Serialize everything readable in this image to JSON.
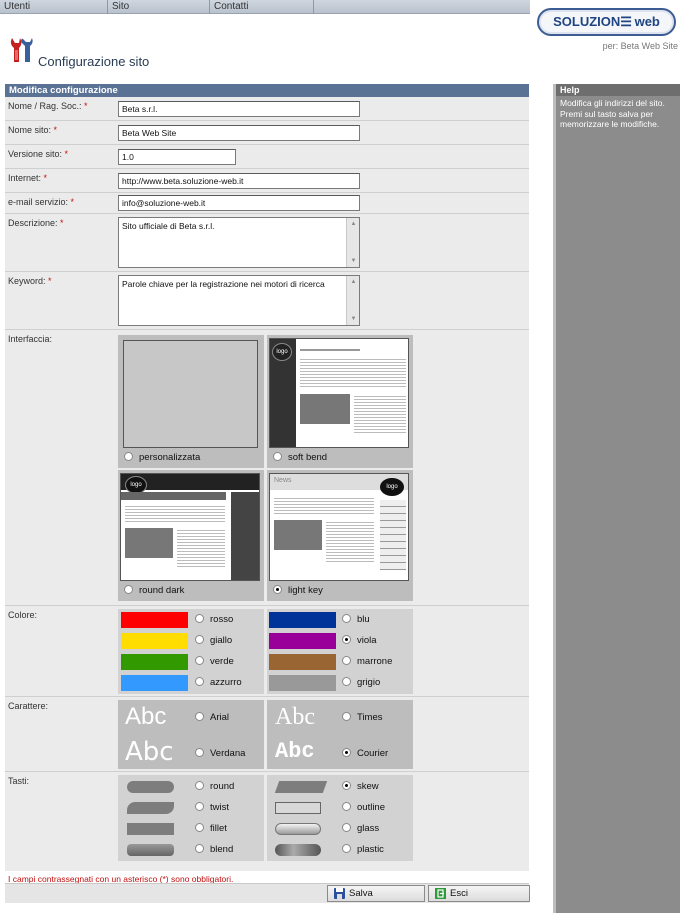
{
  "topnav": {
    "items": [
      "Utenti",
      "Sito",
      "Contatti"
    ]
  },
  "logo": {
    "text_a": "SOLUZION",
    "text_b": "web"
  },
  "byline": "per: Beta Web Site",
  "title": "Configurazione sito",
  "panel_header": "Modifica configurazione",
  "fields": {
    "ragsoc": {
      "label": "Nome / Rag. Soc.:",
      "value": "Beta s.r.l."
    },
    "nome": {
      "label": "Nome sito:",
      "value": "Beta Web Site"
    },
    "versione": {
      "label": "Versione sito:",
      "value": "1.0"
    },
    "internet": {
      "label": "Internet:",
      "value": "http://www.beta.soluzione-web.it"
    },
    "email": {
      "label": "e-mail servizio:",
      "value": "info@soluzione-web.it"
    },
    "descrizione": {
      "label": "Descrizione:",
      "value": "Sito ufficiale di Beta s.r.l."
    },
    "keyword": {
      "label": "Keyword:",
      "value": "Parole chiave per la registrazione nei motori di ricerca"
    }
  },
  "req_mark": "*",
  "interfaccia": {
    "label": "Interfaccia:",
    "options": [
      "personalizzata",
      "soft bend",
      "round dark",
      "light key"
    ],
    "selected": "light key"
  },
  "colore": {
    "label": "Colore:",
    "options": [
      {
        "name": "rosso",
        "hex": "#ff0000"
      },
      {
        "name": "blu",
        "hex": "#003399"
      },
      {
        "name": "giallo",
        "hex": "#ffdd00"
      },
      {
        "name": "viola",
        "hex": "#990099"
      },
      {
        "name": "verde",
        "hex": "#339900"
      },
      {
        "name": "marrone",
        "hex": "#996633"
      },
      {
        "name": "azzurro",
        "hex": "#3399ff"
      },
      {
        "name": "grigio",
        "hex": "#999999"
      }
    ],
    "selected": "viola"
  },
  "carattere": {
    "label": "Carattere:",
    "sample": "Abc",
    "options": [
      "Arial",
      "Times",
      "Verdana",
      "Courier"
    ],
    "selected": "Courier"
  },
  "tasti": {
    "label": "Tasti:",
    "options": [
      "round",
      "skew",
      "twist",
      "outline",
      "fillet",
      "glass",
      "blend",
      "plastic"
    ],
    "selected": "skew"
  },
  "note": "I campi contrassegnati con un asterisco (*) sono obbligatori.",
  "buttons": {
    "save": "Salva",
    "exit": "Esci"
  },
  "help": {
    "title": "Help",
    "text": "Modifica gli indirizzi del sito. Premi sul tasto salva per memorizzare le modifiche."
  },
  "theme": {
    "header": "#5a7394",
    "required": "#c01010",
    "help_bg": "#8c8c8c"
  },
  "thumb_text": {
    "logo": "logo",
    "news": "News"
  }
}
